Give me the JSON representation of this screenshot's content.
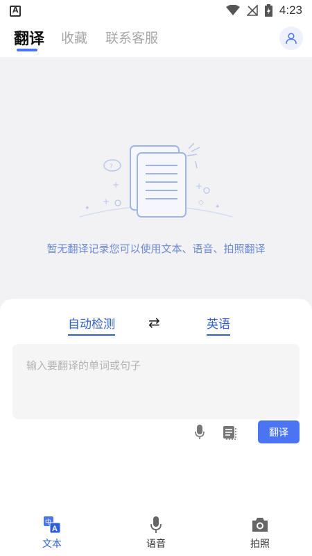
{
  "status_bar": {
    "time": "4:23"
  },
  "tabs": [
    {
      "label": "翻译",
      "active": true
    },
    {
      "label": "收藏",
      "active": false
    },
    {
      "label": "联系客服",
      "active": false
    }
  ],
  "empty_state": {
    "message": "暂无翻译记录您可以使用文本、语音、拍照翻译"
  },
  "translator": {
    "source_lang": "自动检测",
    "target_lang": "英语",
    "swap_symbol": "⇄",
    "input_placeholder": "输入要翻译的单词或句子",
    "translate_label": "翻译"
  },
  "bottom_nav": [
    {
      "label": "文本",
      "icon": "translate-text-icon",
      "active": true
    },
    {
      "label": "语音",
      "icon": "microphone-icon",
      "active": false
    },
    {
      "label": "拍照",
      "icon": "camera-icon",
      "active": false
    }
  ],
  "colors": {
    "accent": "#4b74f2",
    "accent_text": "#2f5fd4",
    "background": "#f2f2f4"
  }
}
